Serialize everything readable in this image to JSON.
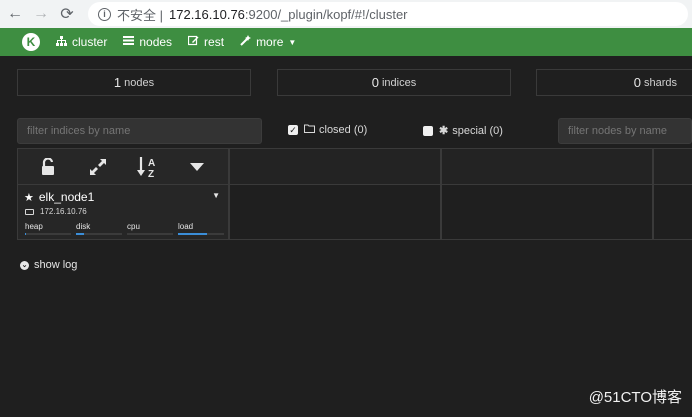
{
  "browser": {
    "back_icon": "arrow-left",
    "forward_icon": "arrow-right",
    "reload_icon": "reload",
    "info_icon": "info",
    "insecure_label": "不安全 |",
    "url_host": "172.16.10.76",
    "url_rest": ":9200/_plugin/kopf/#!/cluster"
  },
  "navbar": {
    "logo": "K",
    "items": [
      {
        "label": "cluster",
        "icon": "sitemap-icon"
      },
      {
        "label": "nodes",
        "icon": "list-icon"
      },
      {
        "label": "rest",
        "icon": "edit-icon"
      },
      {
        "label": "more",
        "icon": "wand-icon"
      }
    ],
    "accent": "#3e8e41"
  },
  "stats": {
    "nodes": {
      "value": "1",
      "label": "nodes"
    },
    "indices": {
      "value": "0",
      "label": "indices"
    },
    "shards": {
      "value": "0",
      "label": "shards"
    }
  },
  "filters": {
    "indices_placeholder": "filter indices by name",
    "nodes_placeholder": "filter nodes by name",
    "closed": {
      "label": "closed (0)",
      "checked": true,
      "icon": "folder-icon"
    },
    "special": {
      "label": "special (0)",
      "checked": false,
      "icon": "asterisk-icon"
    }
  },
  "toolbar": {
    "icons": [
      "unlock-icon",
      "expand-icon",
      "sort-alpha-icon",
      "caret-down-icon"
    ]
  },
  "node": {
    "name": "elk_node1",
    "ip": "172.16.10.76",
    "metrics": [
      {
        "label": "heap",
        "fill": 0.03
      },
      {
        "label": "disk",
        "fill": 0.18
      },
      {
        "label": "cpu",
        "fill": 0.0
      },
      {
        "label": "load",
        "fill": 0.62
      }
    ]
  },
  "showlog": {
    "label": "show log"
  },
  "watermark": "@51CTO博客"
}
